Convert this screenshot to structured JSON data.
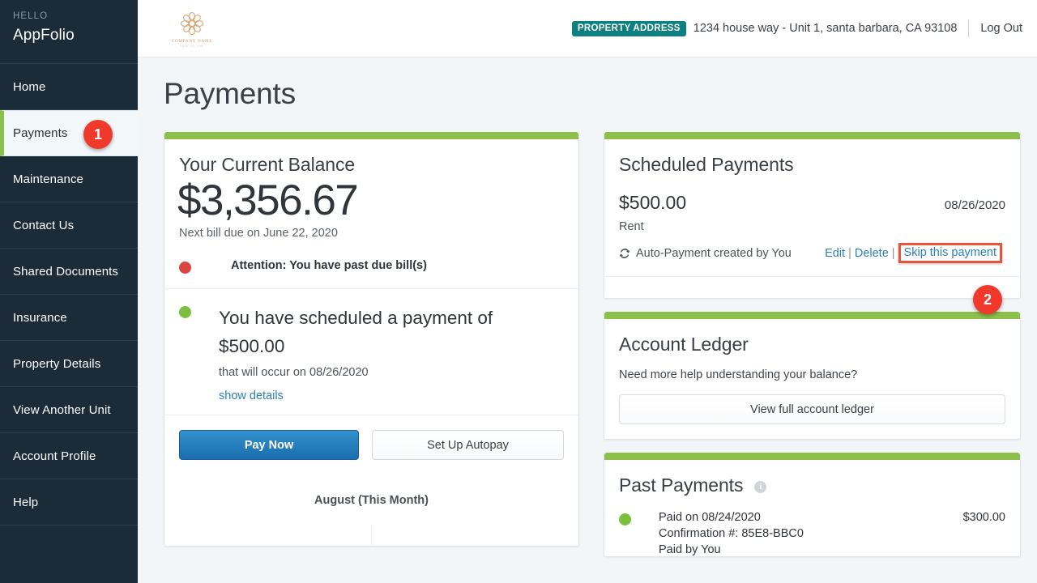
{
  "sidebar": {
    "hello_label": "HELLO",
    "user_name": "AppFolio",
    "items": [
      {
        "label": "Home"
      },
      {
        "label": "Payments",
        "badge": "1"
      },
      {
        "label": "Maintenance"
      },
      {
        "label": "Contact Us"
      },
      {
        "label": "Shared Documents"
      },
      {
        "label": "Insurance"
      },
      {
        "label": "Property Details"
      },
      {
        "label": "View Another Unit"
      },
      {
        "label": "Account Profile"
      },
      {
        "label": "Help"
      }
    ]
  },
  "topbar": {
    "logo_company": "COMPANY NAME",
    "logo_sub": "YOUR TAG LINE",
    "address_badge": "PROPERTY ADDRESS",
    "address": "1234 house way - Unit 1, santa barbara, CA 93108",
    "logout_label": "Log Out"
  },
  "page": {
    "title": "Payments"
  },
  "balance_card": {
    "title": "Your Current Balance",
    "amount": "$3,356.67",
    "next_bill": "Next bill due on June 22, 2020",
    "alert_text": "Attention: You have past due bill(s)",
    "scheduled_headline": "You have scheduled a payment of $500.00",
    "scheduled_sub": "that will occur on 08/26/2020",
    "show_details_label": "show details",
    "pay_now_label": "Pay Now",
    "autopay_label": "Set Up Autopay",
    "month_label": "August (This Month)"
  },
  "scheduled_card": {
    "title": "Scheduled Payments",
    "amount": "$500.00",
    "date": "08/26/2020",
    "type": "Rent",
    "auto_text": "Auto-Payment created by You",
    "edit_label": "Edit",
    "delete_label": "Delete",
    "skip_label": "Skip this payment",
    "separator": "|",
    "badge": "2"
  },
  "ledger_card": {
    "title": "Account Ledger",
    "question": "Need more help understanding your balance?",
    "button_label": "View full account ledger"
  },
  "past_payments_card": {
    "title": "Past Payments",
    "info_glyph": "i",
    "items": [
      {
        "paid_on": "Paid on 08/24/2020",
        "amount": "$300.00",
        "confirmation": "Confirmation #: 85E8-BBC0",
        "paid_by": "Paid by You"
      }
    ]
  },
  "colors": {
    "accent_green": "#8cc04a",
    "sidebar_dark": "#1b2b38",
    "badge_red": "#f0392b",
    "highlight_orange": "#e8553c",
    "link_blue": "#2b7fc0",
    "teal_badge": "#0d8080",
    "primary_blue": "#2b7fc0"
  }
}
